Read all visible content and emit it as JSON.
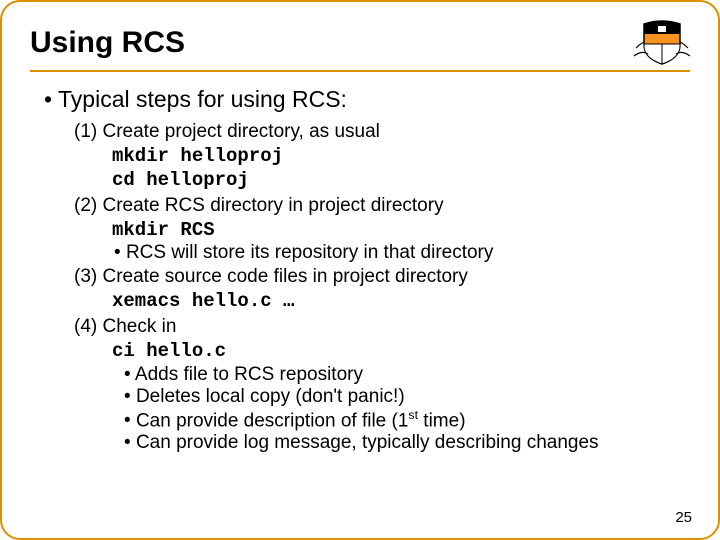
{
  "title": "Using RCS",
  "top_bullet": "Typical steps for using RCS:",
  "step1": {
    "label": "(1) Create project directory, as usual",
    "code1": "mkdir helloproj",
    "code2": "cd helloproj"
  },
  "step2": {
    "label": "(2) Create RCS directory in project directory",
    "code1": "mkdir RCS",
    "note": "RCS will store its repository in that directory"
  },
  "step3": {
    "label": "(3) Create source code files in project directory",
    "code1": "xemacs hello.c …"
  },
  "step4": {
    "label": "(4) Check in",
    "code1": "ci hello.c",
    "b1": "Adds file to RCS repository",
    "b2": "Deletes local copy (don't panic!)",
    "b3_pre": "Can provide description of file (1",
    "b3_sup": "st",
    "b3_post": " time)",
    "b4": "Can provide log message, typically describing changes"
  },
  "page_num": "25"
}
